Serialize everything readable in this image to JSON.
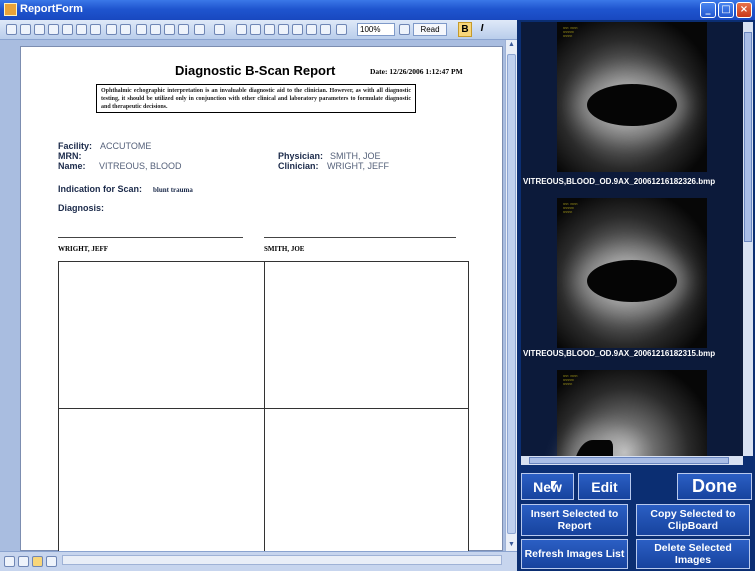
{
  "window": {
    "title": "ReportForm",
    "minimize_glyph": "_",
    "maximize_glyph": "□",
    "close_glyph": "×"
  },
  "toolbar": {
    "zoom": "100%",
    "read_label": "Read",
    "bold_label": "B",
    "italic_label": "I"
  },
  "report": {
    "title": "Diagnostic B-Scan Report",
    "date": "Date: 12/26/2006 1:12:47 PM",
    "disclaimer": "Ophthalmic echographic interpretation is an invaluable diagnostic aid to the clinician. However, as with all diagnostic testing, it should be utilized only in conjunction with other clinical and laboratory parameters to formulate diagnostic and therapeutic decisions.",
    "facility_label": "Facility:",
    "facility": "ACCUTOME",
    "mrn_label": "MRN:",
    "mrn": "",
    "name_label": "Name:",
    "name": "VITREOUS, BLOOD",
    "physician_label": "Physician:",
    "physician": "SMITH, JOE",
    "clinician_label": "Clinician:",
    "clinician": "WRIGHT, JEFF",
    "indication_label": "Indication for Scan:",
    "indication": "blunt trauma",
    "diagnosis_label": "Diagnosis:",
    "diagnosis": "",
    "signature_left": "WRIGHT, JEFF",
    "signature_right": "SMITH, JOE"
  },
  "images": [
    {
      "filename": "VITREOUS,BLOOD_OD.9AX_20061216182326.bmp"
    },
    {
      "filename": "VITREOUS,BLOOD_OD.9AX_20061216182315.bmp"
    },
    {
      "filename": ""
    }
  ],
  "buttons": {
    "new": "New",
    "edit": "Edit",
    "done": "Done",
    "insert": "Insert Selected to Report",
    "copy": "Copy Selected to ClipBoard",
    "refresh": "Refresh Images List",
    "delete": "Delete Selected Images"
  },
  "colors": {
    "panel_bg": "#0b2e72",
    "button_bg": "#2b5fc4",
    "titlebar": "#1f55cf"
  }
}
